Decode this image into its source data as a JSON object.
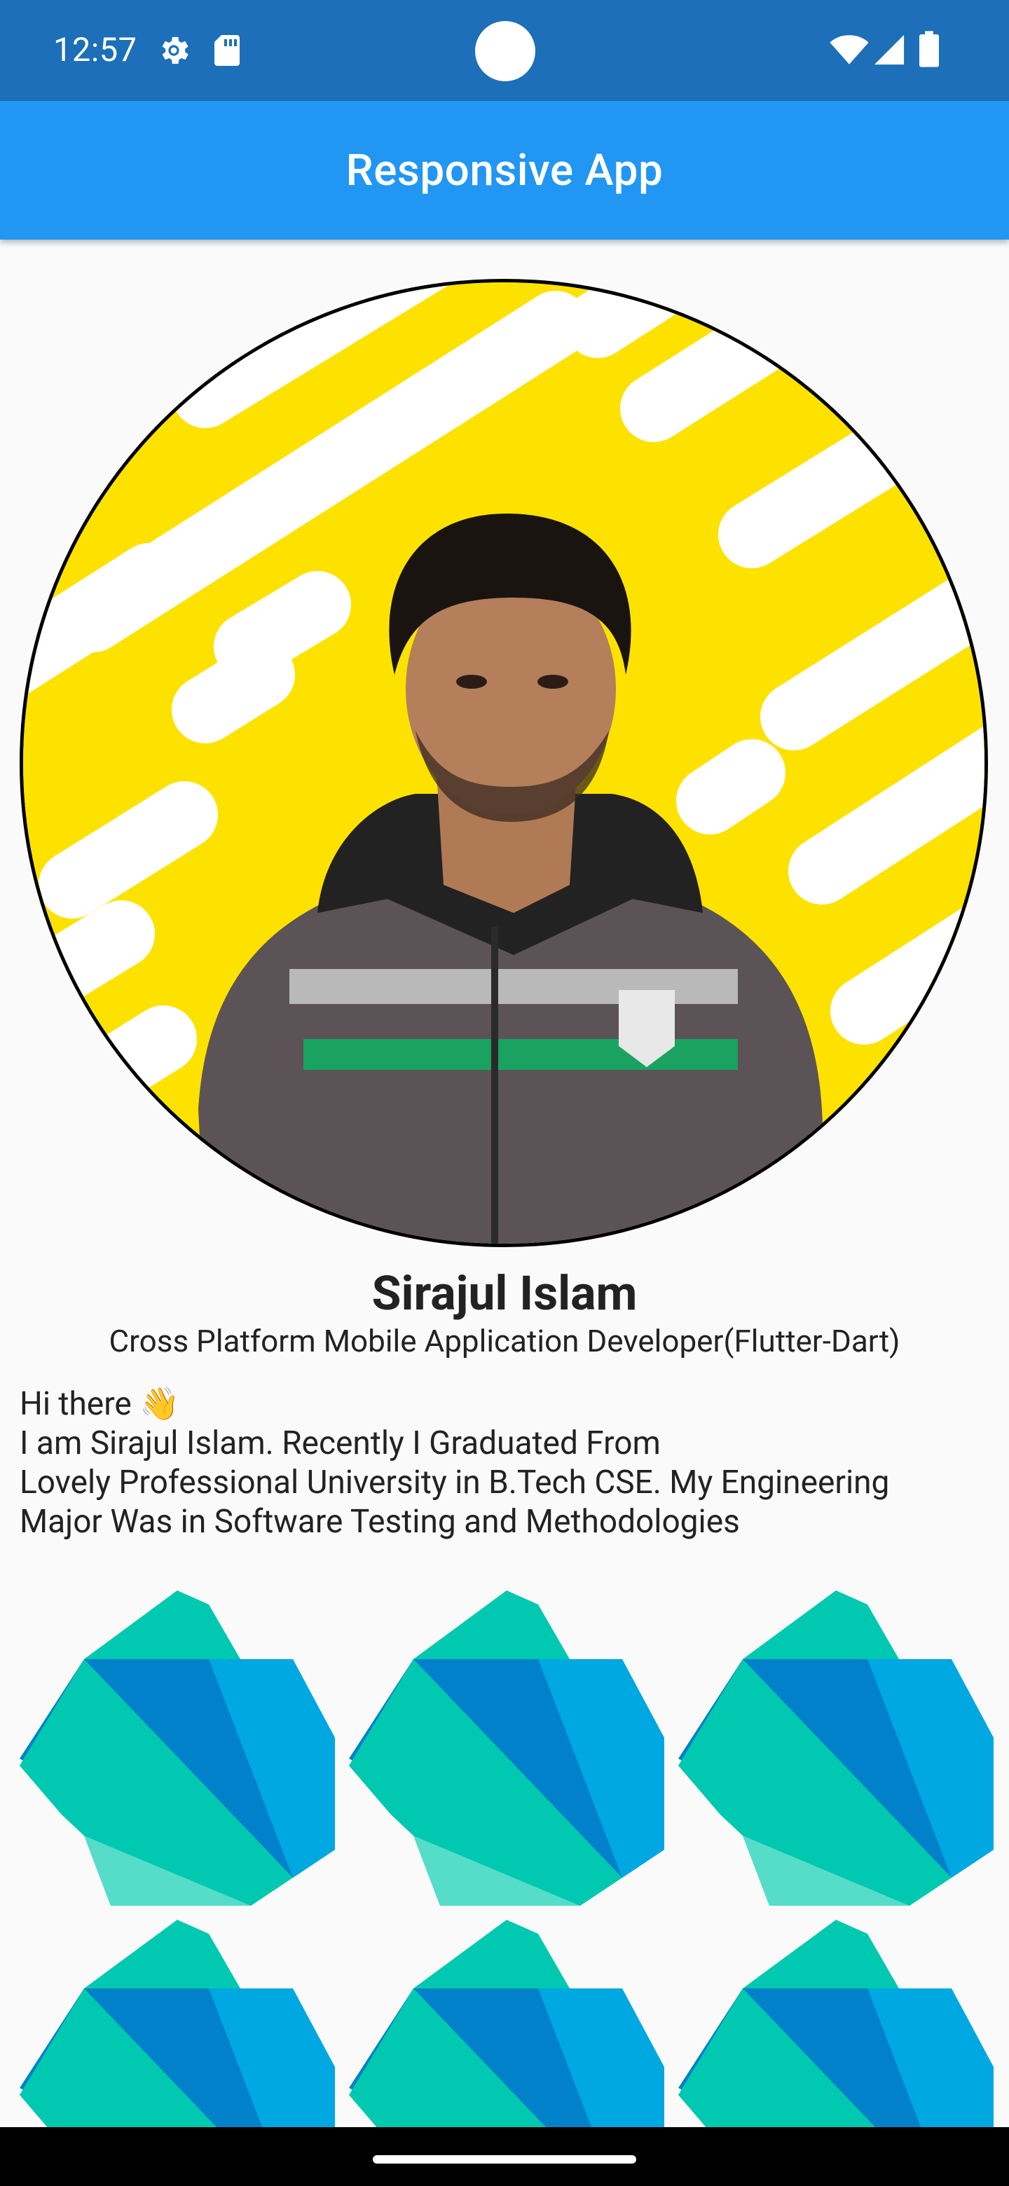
{
  "status_bar": {
    "time": "12:57",
    "icons": [
      "settings-gear-icon",
      "sd-card-icon",
      "wifi-icon",
      "signal-icon",
      "battery-icon"
    ]
  },
  "app_bar": {
    "title": "Responsive App"
  },
  "profile": {
    "name": "Sirajul Islam",
    "role": "Cross Platform Mobile Application Developer(Flutter-Dart)",
    "bio_lines": [
      "Hi there 👋",
      "I am Sirajul Islam. Recently I Graduated From",
      "Lovely Professional University in B.Tech CSE. My Engineering",
      "Major Was in Software Testing and Methodologies"
    ]
  },
  "logo_grid": {
    "icon": "dart-logo-icon",
    "count": 6,
    "columns": 3
  },
  "colors": {
    "status_bar": "#1c6fb8",
    "app_bar": "#2196f3",
    "background": "#fafafa",
    "avatar_yellow": "#fde200",
    "dart_teal": "#01c8b0",
    "dart_blue": "#0081c9",
    "dart_light_blue": "#00a8e1"
  }
}
